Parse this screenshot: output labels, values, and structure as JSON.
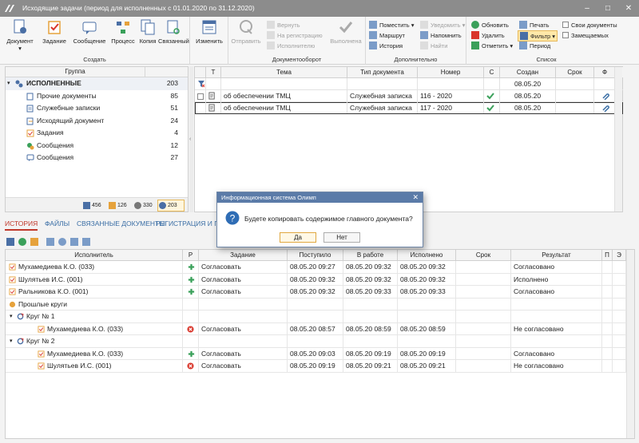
{
  "window": {
    "title": "Исходящие задачи (период для исполненных с 01.01.2020 по 31.12.2020)"
  },
  "ribbon": {
    "create": {
      "caption": "Создать",
      "document": "Документ",
      "task": "Задание",
      "message": "Сообщение",
      "process": "Процесс",
      "copy": "Копия",
      "linked": "Связанный"
    },
    "edit": {
      "label": "Изменить"
    },
    "docflow": {
      "caption": "Документооборот",
      "send": "Отправить",
      "return": "Вернуть",
      "to_register": "На регистрацию",
      "to_executor": "Исполнителю",
      "done": "Выполнена"
    },
    "extra": {
      "caption": "Дополнительно",
      "put": "Поместить",
      "route": "Маршрут",
      "history": "История",
      "notify": "Уведомить",
      "remind": "Напомнить",
      "find": "Найти"
    },
    "list": {
      "caption": "Список",
      "refresh": "Обновить",
      "delete": "Удалить",
      "mark": "Отметить",
      "print": "Печать",
      "filter": "Фильтр",
      "period": "Период",
      "own_docs": "Свои документы",
      "substituted": "Замещаемых"
    }
  },
  "groups": {
    "header": {
      "group": "Группа",
      "count": ""
    },
    "root": {
      "label": "ИСПОЛНЕННЫЕ",
      "count": "203"
    },
    "items": [
      {
        "label": "Прочие документы",
        "count": "85"
      },
      {
        "label": "Служебные записки",
        "count": "51"
      },
      {
        "label": "Исходящий документ",
        "count": "24"
      },
      {
        "label": "Задания",
        "count": "4"
      },
      {
        "label": "Сообщения",
        "count": "12"
      },
      {
        "label": "Сообщения",
        "count": "27"
      }
    ],
    "footer": [
      "456",
      "126",
      "330",
      "203"
    ]
  },
  "docs": {
    "columns": {
      "t": "Т",
      "subject": "Тема",
      "doctype": "Тип документа",
      "number": "Номер",
      "c": "С",
      "created": "Создан",
      "deadline": "Срок",
      "f": "Ф"
    },
    "filter_created": "08.05.20",
    "rows": [
      {
        "subject": "об обеспечении ТМЦ",
        "doctype": "Служебная записка",
        "number": "116 - 2020",
        "created": "08.05.20",
        "deadline": ""
      },
      {
        "subject": "об обеспечении ТМЦ",
        "doctype": "Служебная записка",
        "number": "117 - 2020",
        "created": "08.05.20",
        "deadline": ""
      }
    ]
  },
  "tabs": [
    "ИСТОРИЯ",
    "ФАЙЛЫ",
    "СВЯЗАННЫЕ ДОКУМЕНТЫ",
    "РЕГИСТРАЦИЯ И ПАР"
  ],
  "history": {
    "columns": {
      "executor": "Исполнитель",
      "r": "Р",
      "task": "Задание",
      "received": "Поступило",
      "inwork": "В работе",
      "executed": "Исполнено",
      "deadline": "Срок",
      "result": "Результат",
      "p": "П",
      "e": "Э"
    },
    "rows": [
      {
        "executor": "Мухамедиева К.О. (033)",
        "task": "Согласовать",
        "received": "08.05.20 09:27",
        "inwork": "08.05.20 09:32",
        "executed": "08.05.20 09:32",
        "result": "Согласовано"
      },
      {
        "executor": "Шулятьев И.С. (001)",
        "task": "Согласовать",
        "received": "08.05.20 09:32",
        "inwork": "08.05.20 09:32",
        "executed": "08.05.20 09:32",
        "result": "Исполнено"
      },
      {
        "executor": "Ральникова К.О. (001)",
        "task": "Согласовать",
        "received": "08.05.20 09:32",
        "inwork": "08.05.20 09:33",
        "executed": "08.05.20 09:33",
        "result": "Согласовано"
      }
    ],
    "past_label": "Прошлые круги",
    "round1": {
      "label": "Круг № 1",
      "row": {
        "executor": "Мухамедиева К.О. (033)",
        "task": "Согласовать",
        "received": "08.05.20 08:57",
        "inwork": "08.05.20 08:59",
        "executed": "08.05.20 08:59",
        "result": "Не согласовано"
      }
    },
    "round2": {
      "label": "Круг № 2",
      "rows": [
        {
          "executor": "Мухамедиева К.О. (033)",
          "task": "Согласовать",
          "received": "08.05.20 09:03",
          "inwork": "08.05.20 09:19",
          "executed": "08.05.20 09:19",
          "result": "Согласовано"
        },
        {
          "executor": "Шулятьев И.С. (001)",
          "task": "Согласовать",
          "received": "08.05.20 09:19",
          "inwork": "08.05.20 09:21",
          "executed": "08.05.20 09:21",
          "result": "Не согласовано"
        }
      ]
    }
  },
  "dialog": {
    "title": "Информационная система Олимп",
    "message": "Будете копировать содержимое главного документа?",
    "yes": "Да",
    "no": "Нет"
  },
  "colors": {
    "accent": "#3a6ea5",
    "dialog_header": "#5b7ba8",
    "ok_green": "#3aa05a",
    "err_red": "#d9362b",
    "orange": "#e6a23c"
  }
}
